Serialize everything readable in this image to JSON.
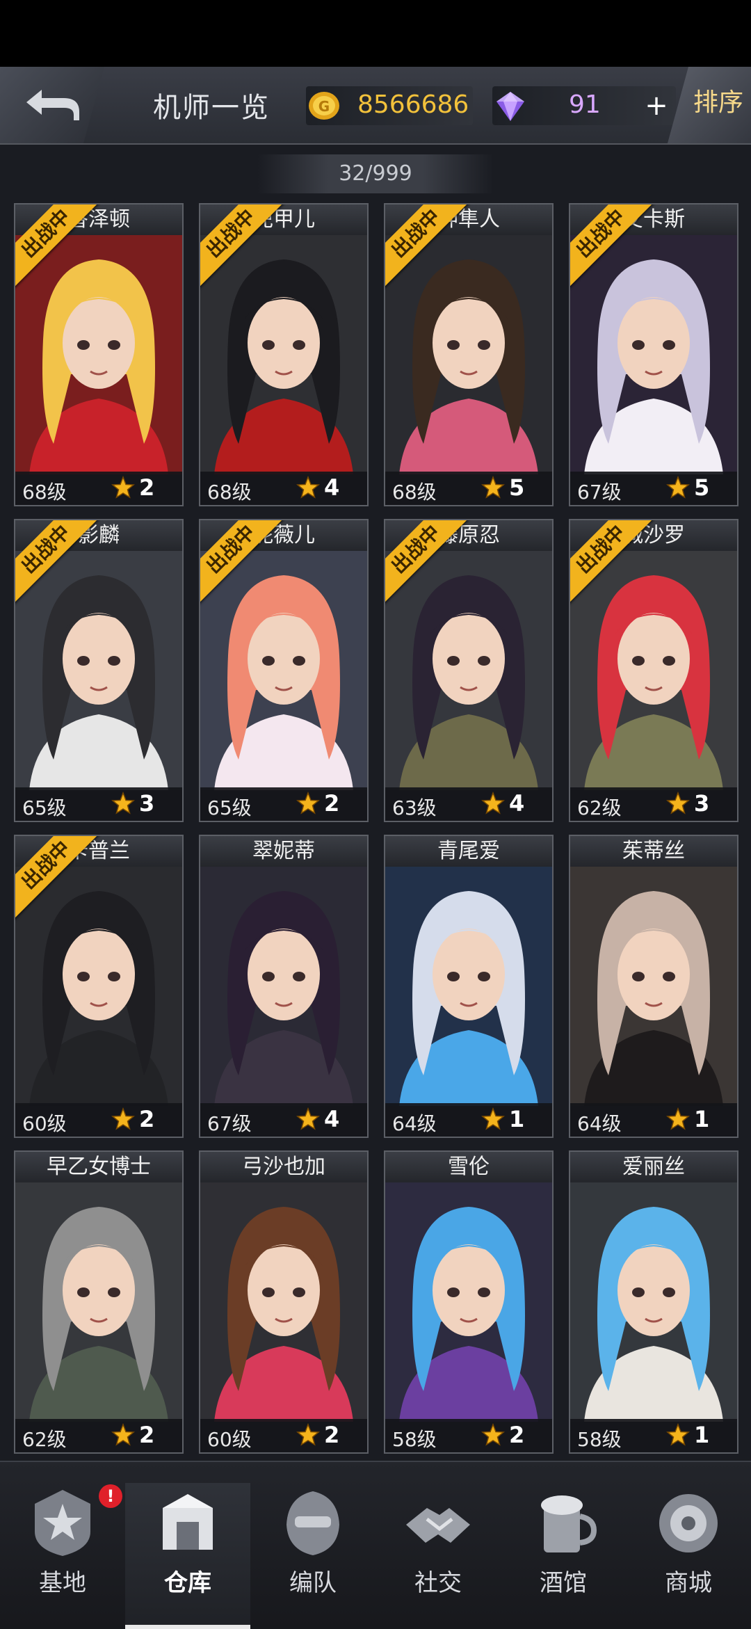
{
  "header": {
    "title": "机师一览",
    "coins": "8566686",
    "gems": "91",
    "plus_label": "+",
    "sort_label": "排序"
  },
  "count": "32/999",
  "colors": {
    "badge": "#f2b31d",
    "coin": "#f3c23b",
    "gem": "#d9a8ff",
    "star": "#f5b41c"
  },
  "badge_text": "出战中",
  "pilots": [
    {
      "name": "香泽顿",
      "level": "68级",
      "stars": "2",
      "in_battle": true,
      "hair": "#f2c34a",
      "bg": "#7a1e1e",
      "outfit": "#c8222a"
    },
    {
      "name": "兜甲儿",
      "level": "68级",
      "stars": "4",
      "in_battle": true,
      "hair": "#1b1b1f",
      "bg": "#2e2f33",
      "outfit": "#b31d1d"
    },
    {
      "name": "神隼人",
      "level": "68级",
      "stars": "5",
      "in_battle": true,
      "hair": "#3a2a20",
      "bg": "#2a2b30",
      "outfit": "#d55a7a"
    },
    {
      "name": "艾卡斯",
      "level": "67级",
      "stars": "5",
      "in_battle": true,
      "hair": "#c9c3dc",
      "bg": "#2b2436",
      "outfit": "#f2eef5"
    },
    {
      "name": "影麟",
      "level": "65级",
      "stars": "3",
      "in_battle": true,
      "hair": "#2c2c30",
      "bg": "#3a3d44",
      "outfit": "#e6e6e6"
    },
    {
      "name": "妮薇儿",
      "level": "65级",
      "stars": "2",
      "in_battle": true,
      "hair": "#f08a72",
      "bg": "#3d4150",
      "outfit": "#f4e7ef"
    },
    {
      "name": "藤原忍",
      "level": "63级",
      "stars": "4",
      "in_battle": true,
      "hair": "#2a2333",
      "bg": "#35373d",
      "outfit": "#6d6a4a"
    },
    {
      "name": "城沙罗",
      "level": "62级",
      "stars": "3",
      "in_battle": true,
      "hair": "#d8333f",
      "bg": "#3a3b3e",
      "outfit": "#7a7a55"
    },
    {
      "name": "卡普兰",
      "level": "60级",
      "stars": "2",
      "in_battle": true,
      "hair": "#1e1e22",
      "bg": "#2a2b2f",
      "outfit": "#222326"
    },
    {
      "name": "翠妮蒂",
      "level": "67级",
      "stars": "4",
      "in_battle": false,
      "hair": "#2a1f33",
      "bg": "#2b2a35",
      "outfit": "#3a3342"
    },
    {
      "name": "青尾爱",
      "level": "64级",
      "stars": "1",
      "in_battle": false,
      "hair": "#d5dceb",
      "bg": "#22314a",
      "outfit": "#4aa7e8"
    },
    {
      "name": "茱蒂丝",
      "level": "64级",
      "stars": "1",
      "in_battle": false,
      "hair": "#c7b2a6",
      "bg": "#3b3634",
      "outfit": "#1e1b1c"
    },
    {
      "name": "早乙女博士",
      "level": "62级",
      "stars": "2",
      "in_battle": false,
      "hair": "#8f8f8f",
      "bg": "#36383c",
      "outfit": "#4f5a4e"
    },
    {
      "name": "弓沙也加",
      "level": "60级",
      "stars": "2",
      "in_battle": false,
      "hair": "#6b3d26",
      "bg": "#2f2f34",
      "outfit": "#d83a5a"
    },
    {
      "name": "雪伦",
      "level": "58级",
      "stars": "2",
      "in_battle": false,
      "hair": "#4aa6e6",
      "bg": "#2d2b40",
      "outfit": "#6b3fa0"
    },
    {
      "name": "爱丽丝",
      "level": "58级",
      "stars": "1",
      "in_battle": false,
      "hair": "#5bb3ea",
      "bg": "#34383d",
      "outfit": "#e9e5df"
    }
  ],
  "nav": [
    {
      "label": "基地",
      "icon": "base-icon",
      "active": false,
      "alert": "!"
    },
    {
      "label": "仓库",
      "icon": "warehouse-icon",
      "active": true,
      "alert": ""
    },
    {
      "label": "编队",
      "icon": "formation-icon",
      "active": false,
      "alert": ""
    },
    {
      "label": "社交",
      "icon": "social-icon",
      "active": false,
      "alert": ""
    },
    {
      "label": "酒馆",
      "icon": "tavern-icon",
      "active": false,
      "alert": ""
    },
    {
      "label": "商城",
      "icon": "shop-icon",
      "active": false,
      "alert": ""
    }
  ]
}
